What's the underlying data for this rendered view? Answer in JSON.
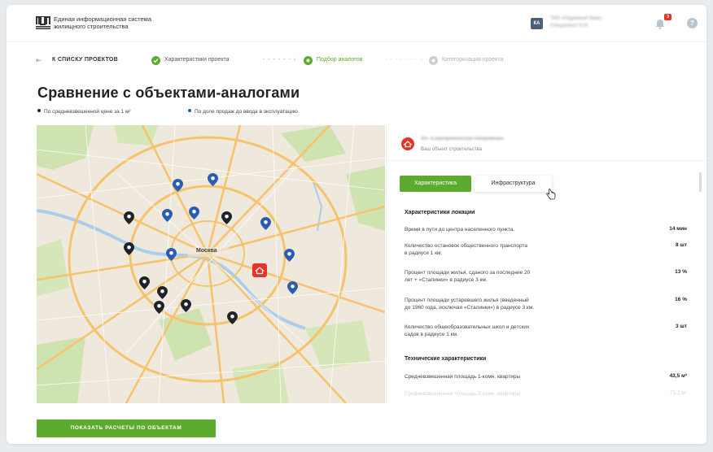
{
  "header": {
    "system_name_line1": "Единая информационная система",
    "system_name_line2": "жилищного строительства",
    "user_initials": "КА",
    "org_line1": "ТКО «Надежный банк»",
    "org_line2": "Специалист О.Н.",
    "notifications_count": "3",
    "help_label": "?"
  },
  "steps": {
    "back_label": "К СПИСКУ ПРОЕКТОВ",
    "step1": "Характеристики проекта",
    "step2": "Подбор аналогов",
    "step3": "Категоризация проекта"
  },
  "page": {
    "title": "Сравнение с объектами-аналогами",
    "legend_price": "По средневзвешенной цене за 1 м²",
    "legend_sales": "По доле продаж до ввода в эксплуатацию"
  },
  "map": {
    "center_label": "Москва"
  },
  "panel": {
    "object_name": "ЖК «Серебряническая набережная»",
    "object_sub": "Ваш объект строительства",
    "tab_active": "Характеристика",
    "tab_other": "Инфраструктура",
    "section1": "Характеристики локации",
    "rows": [
      {
        "l1": "Время в пути до центра населенного пункта.",
        "l2": "",
        "v": "14 мин"
      },
      {
        "l1": "Количество остановок общественного транспорта",
        "l2": "в радиусе 1 км.",
        "v": "8 шт"
      },
      {
        "l1": "Процент площади жилья, сданого за последние 20",
        "l2": "лет + «Сталинки» в радиусе 3 км.",
        "v": "13 %"
      },
      {
        "l1": "Процент площади устаревшего жилья (введенный",
        "l2": "до 1960 года, исключая «Сталинки») в радиусе 3 км.",
        "v": "16 %"
      },
      {
        "l1": "Количество общеобразовательных школ и детских",
        "l2": "садов в радиусе 1 км.",
        "v": "3 шт"
      }
    ],
    "section2": "Технические характеристики",
    "tech_rows": [
      {
        "l1": "Средневзвешенная площадь 1-комн. квартиры",
        "v": "43,5 м²"
      },
      {
        "l1": "Средневзвешенная площадь 2-комн. квартиры",
        "v": "71,2 м²"
      }
    ]
  },
  "cta": {
    "label": "ПОКАЗАТЬ РАСЧЕТЫ ПО ОБЪЕКТАМ"
  },
  "colors": {
    "accent": "#5dab2e",
    "danger": "#e5332a",
    "pin_blue": "#2a5db0",
    "pin_dark": "#1d2329"
  }
}
